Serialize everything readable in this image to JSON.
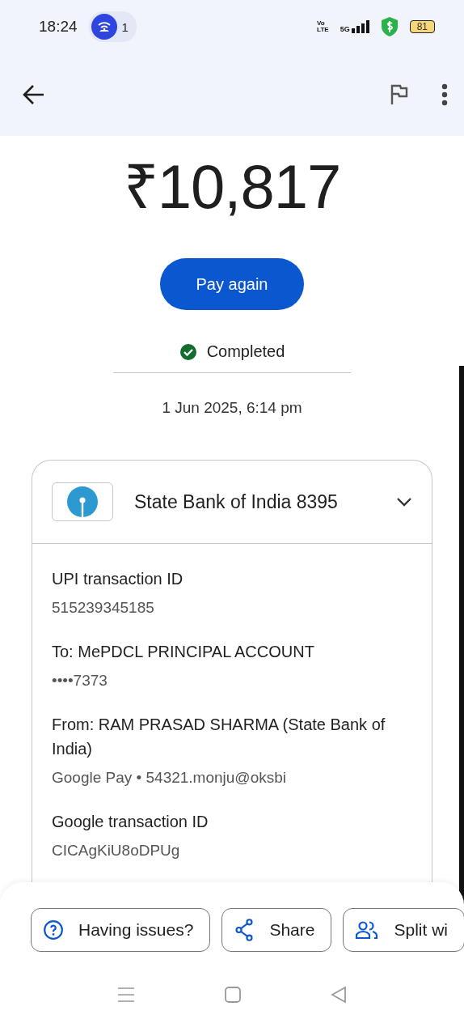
{
  "status_bar": {
    "time": "18:24",
    "notification_count": "1",
    "volte": [
      "Vo",
      "LTE"
    ],
    "network": "5G",
    "battery": "81"
  },
  "amount": "₹10,817",
  "pay_again": "Pay again",
  "status": {
    "label": "Completed",
    "completed": true
  },
  "date": "1 Jun 2025, 6:14 pm",
  "account": {
    "name": "State Bank of India 8395",
    "expanded": false
  },
  "details": [
    {
      "label": "UPI transaction ID",
      "value": "515239345185"
    },
    {
      "label": "To: MePDCL PRINCIPAL ACCOUNT",
      "value": "••••7373"
    },
    {
      "label": "From: RAM PRASAD SHARMA (State Bank of India)",
      "value": "Google Pay • 54321.monju@oksbi"
    },
    {
      "label": "Google transaction ID",
      "value": "CICAgKiU8oDPUg"
    }
  ],
  "actions": [
    {
      "kind": "help",
      "label": "Having issues?"
    },
    {
      "kind": "share",
      "label": "Share"
    },
    {
      "kind": "split",
      "label": "Split wi"
    }
  ]
}
